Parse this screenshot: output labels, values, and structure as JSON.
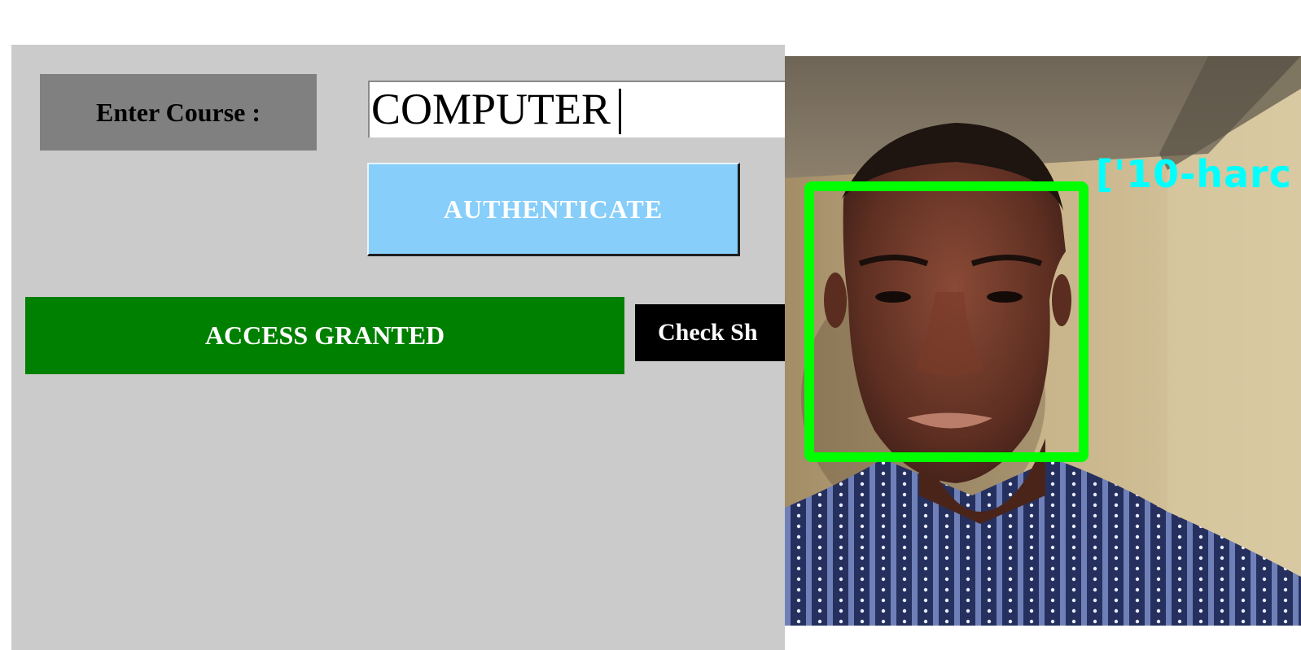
{
  "form": {
    "course_label": "Enter Course :",
    "course_value": "COMPUTER",
    "authenticate_label": "AUTHENTICATE",
    "status_text": "ACCESS GRANTED",
    "check_button_label": "Check Sh"
  },
  "camera": {
    "detection_label": "['10-harc",
    "box_color": "#00ff00",
    "label_color": "#00ffff"
  },
  "colors": {
    "panel_bg": "#cbcbcb",
    "label_bg": "#808080",
    "authenticate_bg": "#87cefa",
    "access_granted_bg": "#008000",
    "check_button_bg": "#000000"
  }
}
